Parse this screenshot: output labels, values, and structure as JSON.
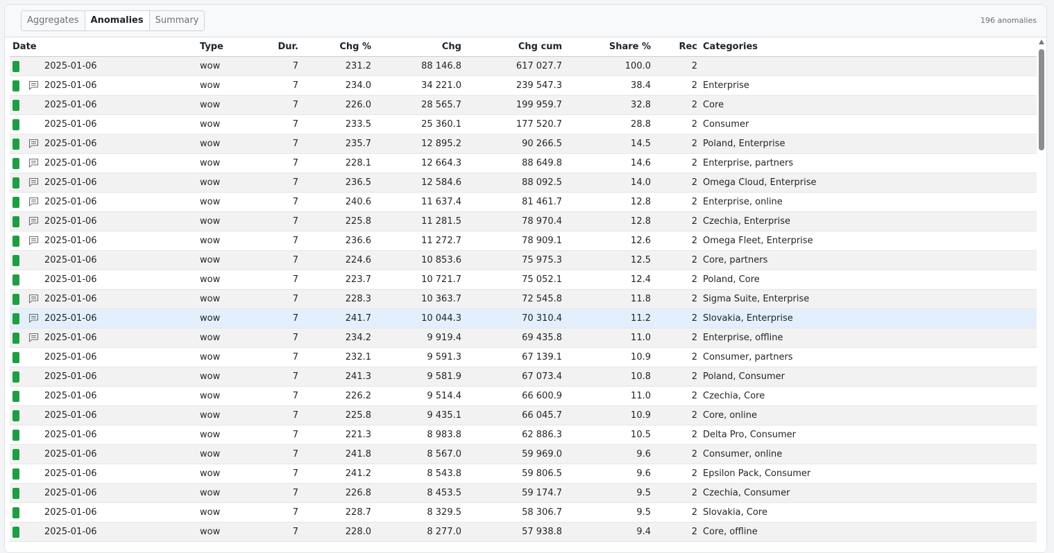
{
  "tabs": [
    "Aggregates",
    "Anomalies",
    "Summary"
  ],
  "active_tab": "Anomalies",
  "anomaly_count": "196 anomalies",
  "colors": {
    "bar_green": "#1e9e43",
    "selected_row": "#e3effd",
    "alt_row": "#f2f2f2"
  },
  "columns": [
    "Date",
    "Type",
    "Dur.",
    "Chg %",
    "Chg",
    "Chg cum",
    "Share %",
    "Rec",
    "Categories"
  ],
  "rows": [
    {
      "date": "2025-01-06",
      "comment": false,
      "type": "wow",
      "dur": "7",
      "chg_pct": "231.2",
      "chg": "88 146.8",
      "chg_cum": "617 027.7",
      "share": "100.0",
      "rec": "2",
      "categories": ""
    },
    {
      "date": "2025-01-06",
      "comment": true,
      "type": "wow",
      "dur": "7",
      "chg_pct": "234.0",
      "chg": "34 221.0",
      "chg_cum": "239 547.3",
      "share": "38.4",
      "rec": "2",
      "categories": "Enterprise"
    },
    {
      "date": "2025-01-06",
      "comment": false,
      "type": "wow",
      "dur": "7",
      "chg_pct": "226.0",
      "chg": "28 565.7",
      "chg_cum": "199 959.7",
      "share": "32.8",
      "rec": "2",
      "categories": "Core"
    },
    {
      "date": "2025-01-06",
      "comment": false,
      "type": "wow",
      "dur": "7",
      "chg_pct": "233.5",
      "chg": "25 360.1",
      "chg_cum": "177 520.7",
      "share": "28.8",
      "rec": "2",
      "categories": "Consumer"
    },
    {
      "date": "2025-01-06",
      "comment": true,
      "type": "wow",
      "dur": "7",
      "chg_pct": "235.7",
      "chg": "12 895.2",
      "chg_cum": "90 266.5",
      "share": "14.5",
      "rec": "2",
      "categories": "Poland, Enterprise"
    },
    {
      "date": "2025-01-06",
      "comment": true,
      "type": "wow",
      "dur": "7",
      "chg_pct": "228.1",
      "chg": "12 664.3",
      "chg_cum": "88 649.8",
      "share": "14.6",
      "rec": "2",
      "categories": "Enterprise, partners"
    },
    {
      "date": "2025-01-06",
      "comment": true,
      "type": "wow",
      "dur": "7",
      "chg_pct": "236.5",
      "chg": "12 584.6",
      "chg_cum": "88 092.5",
      "share": "14.0",
      "rec": "2",
      "categories": "Omega Cloud, Enterprise"
    },
    {
      "date": "2025-01-06",
      "comment": true,
      "type": "wow",
      "dur": "7",
      "chg_pct": "240.6",
      "chg": "11 637.4",
      "chg_cum": "81 461.7",
      "share": "12.8",
      "rec": "2",
      "categories": "Enterprise, online"
    },
    {
      "date": "2025-01-06",
      "comment": true,
      "type": "wow",
      "dur": "7",
      "chg_pct": "225.8",
      "chg": "11 281.5",
      "chg_cum": "78 970.4",
      "share": "12.8",
      "rec": "2",
      "categories": "Czechia, Enterprise"
    },
    {
      "date": "2025-01-06",
      "comment": true,
      "type": "wow",
      "dur": "7",
      "chg_pct": "236.6",
      "chg": "11 272.7",
      "chg_cum": "78 909.1",
      "share": "12.6",
      "rec": "2",
      "categories": "Omega Fleet, Enterprise"
    },
    {
      "date": "2025-01-06",
      "comment": false,
      "type": "wow",
      "dur": "7",
      "chg_pct": "224.6",
      "chg": "10 853.6",
      "chg_cum": "75 975.3",
      "share": "12.5",
      "rec": "2",
      "categories": "Core, partners"
    },
    {
      "date": "2025-01-06",
      "comment": false,
      "type": "wow",
      "dur": "7",
      "chg_pct": "223.7",
      "chg": "10 721.7",
      "chg_cum": "75 052.1",
      "share": "12.4",
      "rec": "2",
      "categories": "Poland, Core"
    },
    {
      "date": "2025-01-06",
      "comment": true,
      "type": "wow",
      "dur": "7",
      "chg_pct": "228.3",
      "chg": "10 363.7",
      "chg_cum": "72 545.8",
      "share": "11.8",
      "rec": "2",
      "categories": "Sigma Suite, Enterprise"
    },
    {
      "date": "2025-01-06",
      "comment": true,
      "type": "wow",
      "dur": "7",
      "chg_pct": "241.7",
      "chg": "10 044.3",
      "chg_cum": "70 310.4",
      "share": "11.2",
      "rec": "2",
      "categories": "Slovakia, Enterprise",
      "selected": true
    },
    {
      "date": "2025-01-06",
      "comment": true,
      "type": "wow",
      "dur": "7",
      "chg_pct": "234.2",
      "chg": "9 919.4",
      "chg_cum": "69 435.8",
      "share": "11.0",
      "rec": "2",
      "categories": "Enterprise, offline"
    },
    {
      "date": "2025-01-06",
      "comment": false,
      "type": "wow",
      "dur": "7",
      "chg_pct": "232.1",
      "chg": "9 591.3",
      "chg_cum": "67 139.1",
      "share": "10.9",
      "rec": "2",
      "categories": "Consumer, partners"
    },
    {
      "date": "2025-01-06",
      "comment": false,
      "type": "wow",
      "dur": "7",
      "chg_pct": "241.3",
      "chg": "9 581.9",
      "chg_cum": "67 073.4",
      "share": "10.8",
      "rec": "2",
      "categories": "Poland, Consumer"
    },
    {
      "date": "2025-01-06",
      "comment": false,
      "type": "wow",
      "dur": "7",
      "chg_pct": "226.2",
      "chg": "9 514.4",
      "chg_cum": "66 600.9",
      "share": "11.0",
      "rec": "2",
      "categories": "Czechia, Core"
    },
    {
      "date": "2025-01-06",
      "comment": false,
      "type": "wow",
      "dur": "7",
      "chg_pct": "225.8",
      "chg": "9 435.1",
      "chg_cum": "66 045.7",
      "share": "10.9",
      "rec": "2",
      "categories": "Core, online"
    },
    {
      "date": "2025-01-06",
      "comment": false,
      "type": "wow",
      "dur": "7",
      "chg_pct": "221.3",
      "chg": "8 983.8",
      "chg_cum": "62 886.3",
      "share": "10.5",
      "rec": "2",
      "categories": "Delta Pro, Consumer"
    },
    {
      "date": "2025-01-06",
      "comment": false,
      "type": "wow",
      "dur": "7",
      "chg_pct": "241.8",
      "chg": "8 567.0",
      "chg_cum": "59 969.0",
      "share": "9.6",
      "rec": "2",
      "categories": "Consumer, online"
    },
    {
      "date": "2025-01-06",
      "comment": false,
      "type": "wow",
      "dur": "7",
      "chg_pct": "241.2",
      "chg": "8 543.8",
      "chg_cum": "59 806.5",
      "share": "9.6",
      "rec": "2",
      "categories": "Epsilon Pack, Consumer"
    },
    {
      "date": "2025-01-06",
      "comment": false,
      "type": "wow",
      "dur": "7",
      "chg_pct": "226.8",
      "chg": "8 453.5",
      "chg_cum": "59 174.7",
      "share": "9.5",
      "rec": "2",
      "categories": "Czechia, Consumer"
    },
    {
      "date": "2025-01-06",
      "comment": false,
      "type": "wow",
      "dur": "7",
      "chg_pct": "228.7",
      "chg": "8 329.5",
      "chg_cum": "58 306.7",
      "share": "9.5",
      "rec": "2",
      "categories": "Slovakia, Core"
    },
    {
      "date": "2025-01-06",
      "comment": false,
      "type": "wow",
      "dur": "7",
      "chg_pct": "228.0",
      "chg": "8 277.0",
      "chg_cum": "57 938.8",
      "share": "9.4",
      "rec": "2",
      "categories": "Core, offline"
    }
  ]
}
